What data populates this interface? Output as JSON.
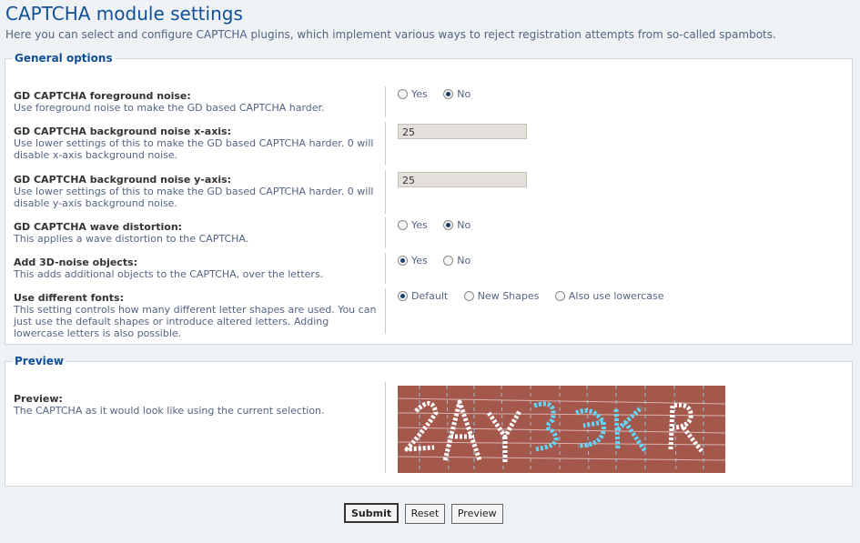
{
  "page": {
    "title": "CAPTCHA module settings",
    "intro": "Here you can select and configure CAPTCHA plugins, which implement various ways to reject registration attempts from so-called spambots."
  },
  "general": {
    "legend": "General options",
    "foreground_noise": {
      "title": "GD CAPTCHA foreground noise:",
      "desc": "Use foreground noise to make the GD based CAPTCHA harder.",
      "yes": "Yes",
      "no": "No",
      "selected": "No"
    },
    "bg_x": {
      "title": "GD CAPTCHA background noise x-axis:",
      "desc": "Use lower settings of this to make the GD based CAPTCHA harder. 0 will disable x-axis background noise.",
      "value": "25"
    },
    "bg_y": {
      "title": "GD CAPTCHA background noise y-axis:",
      "desc": "Use lower settings of this to make the GD based CAPTCHA harder. 0 will disable y-axis background noise.",
      "value": "25"
    },
    "wave": {
      "title": "GD CAPTCHA wave distortion:",
      "desc": "This applies a wave distortion to the CAPTCHA.",
      "yes": "Yes",
      "no": "No",
      "selected": "No"
    },
    "noise3d": {
      "title": "Add 3D-noise objects:",
      "desc": "This adds additional objects to the CAPTCHA, over the letters.",
      "yes": "Yes",
      "no": "No",
      "selected": "Yes"
    },
    "fonts": {
      "title": "Use different fonts:",
      "desc": "This setting controls how many different letter shapes are used. You can just use the default shapes or introduce altered letters. Adding lowercase letters is also possible.",
      "opt1": "Default",
      "opt2": "New Shapes",
      "opt3": "Also use lowercase",
      "selected": "Default"
    }
  },
  "preview": {
    "legend": "Preview",
    "title": "Preview:",
    "desc": "The CAPTCHA as it would look like using the current selection.",
    "captcha_text": "2AY3ЭKЯ"
  },
  "buttons": {
    "submit": "Submit",
    "reset": "Reset",
    "preview": "Preview"
  },
  "colors": {
    "heading": "#115098",
    "captcha_bg": "#a4584c"
  }
}
